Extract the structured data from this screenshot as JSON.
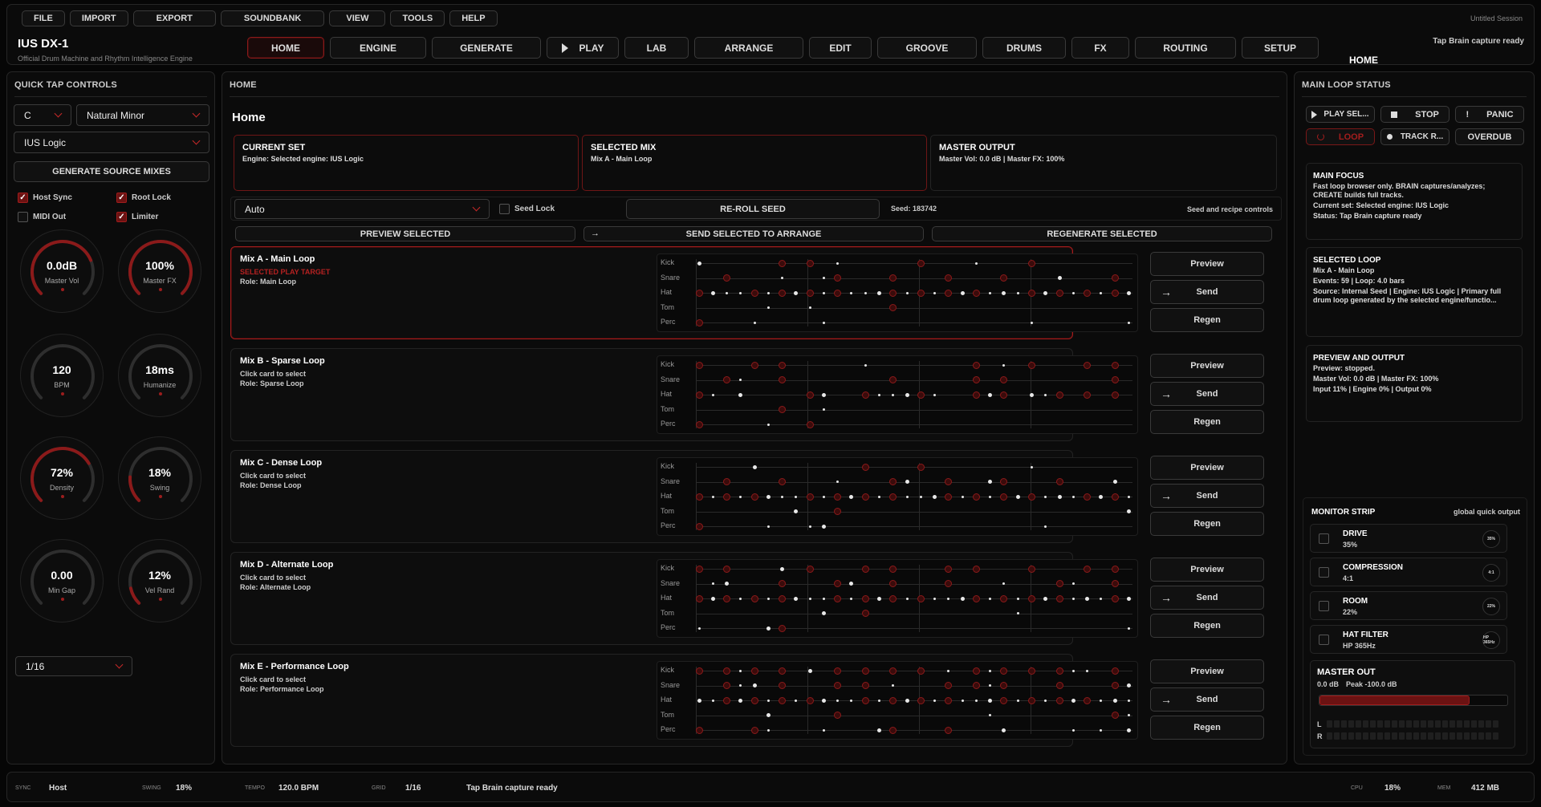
{
  "menu": [
    "FILE",
    "IMPORT",
    "EXPORT",
    "SOUNDBANK",
    "VIEW",
    "TOOLS",
    "HELP"
  ],
  "session": "Untitled Session",
  "app": {
    "title": "IUS DX-1",
    "subtitle": "Official Drum Machine and Rhythm Intelligence Engine"
  },
  "tabs": [
    "HOME",
    "ENGINE",
    "GENERATE",
    "PLAY",
    "LAB",
    "ARRANGE",
    "EDIT",
    "GROOVE",
    "DRUMS",
    "FX",
    "ROUTING",
    "SETUP"
  ],
  "active_tab": "HOME",
  "top_status": "Tap Brain capture ready",
  "left": {
    "title": "QUICK TAP CONTROLS",
    "key": "C",
    "scale": "Natural Minor",
    "engine": "IUS Logic",
    "generate_label": "GENERATE SOURCE MIXES",
    "checks": [
      {
        "label": "Host Sync",
        "on": true
      },
      {
        "label": "Root Lock",
        "on": true
      },
      {
        "label": "MIDI Out",
        "on": false
      },
      {
        "label": "Limiter",
        "on": true
      }
    ],
    "knobs": [
      {
        "value": "0.0dB",
        "label": "Master Vol",
        "level": 0.75
      },
      {
        "value": "100%",
        "label": "Master FX",
        "level": 1.0
      },
      {
        "value": "120",
        "label": "BPM",
        "level": 0.0
      },
      {
        "value": "18ms",
        "label": "Humanize",
        "level": 0.0
      },
      {
        "value": "72%",
        "label": "Density",
        "level": 0.72
      },
      {
        "value": "18%",
        "label": "Swing",
        "level": 0.18
      },
      {
        "value": "0.00",
        "label": "Min Gap",
        "level": 0.0
      },
      {
        "value": "12%",
        "label": "Vel Rand",
        "level": 0.12
      }
    ],
    "grid_value": "1/16"
  },
  "center": {
    "title": "HOME",
    "heading": "Home",
    "boxes": [
      {
        "title": "CURRENT SET",
        "text": "Engine: Selected engine: IUS Logic"
      },
      {
        "title": "SELECTED MIX",
        "text": "Mix A - Main Loop"
      },
      {
        "title": "MASTER OUTPUT",
        "text": "Master Vol: 0.0 dB | Master FX: 100%"
      }
    ],
    "mode": "Auto",
    "seed_lock": "Seed Lock",
    "reroll": "RE-ROLL SEED",
    "seed": "Seed: 183742",
    "seed_note": "Seed and recipe controls",
    "preview_sel": "PREVIEW SELECTED",
    "send_sel": "SEND SELECTED TO ARRANGE",
    "regen_sel": "REGENERATE SELECTED",
    "lanes": [
      "Kick",
      "Snare",
      "Hat",
      "Tom",
      "Perc"
    ],
    "actions": {
      "preview": "Preview",
      "send": "Send",
      "regen": "Regen"
    },
    "mixes": [
      {
        "title": "Mix A - Main Loop",
        "line1": "SELECTED PLAY TARGET",
        "line2": "Role: Main Loop",
        "selected": true,
        "pattern": [
          [
            0,
            6,
            8,
            10,
            16,
            20,
            24
          ],
          [
            2,
            6,
            9,
            10,
            14,
            18,
            22,
            26,
            30
          ],
          [
            0,
            1,
            2,
            3,
            4,
            5,
            6,
            7,
            8,
            9,
            10,
            11,
            12,
            13,
            14,
            15,
            16,
            17,
            18,
            19,
            20,
            21,
            22,
            23,
            24,
            25,
            26,
            27,
            28,
            29,
            30,
            31
          ],
          [
            5,
            8,
            14
          ],
          [
            0,
            4,
            9,
            24,
            31
          ]
        ]
      },
      {
        "title": "Mix B - Sparse Loop",
        "line1": "Click card to select",
        "line2": "Role: Sparse Loop",
        "selected": false,
        "pattern": [
          [
            0,
            4,
            6,
            12,
            20,
            22,
            24,
            28,
            30
          ],
          [
            2,
            3,
            6,
            14,
            20,
            22,
            30
          ],
          [
            0,
            1,
            3,
            8,
            9,
            12,
            13,
            14,
            15,
            16,
            17,
            20,
            21,
            22,
            24,
            25,
            26,
            28,
            30
          ],
          [
            6,
            9
          ],
          [
            0,
            5,
            8
          ]
        ]
      },
      {
        "title": "Mix C - Dense Loop",
        "line1": "Click card to select",
        "line2": "Role: Dense Loop",
        "selected": false,
        "pattern": [
          [
            4,
            12,
            16,
            24
          ],
          [
            2,
            6,
            10,
            14,
            15,
            18,
            21,
            22,
            26,
            30
          ],
          [
            0,
            1,
            2,
            3,
            4,
            5,
            6,
            7,
            8,
            9,
            10,
            11,
            12,
            13,
            14,
            15,
            16,
            17,
            18,
            19,
            20,
            21,
            22,
            23,
            24,
            25,
            26,
            27,
            28,
            29,
            30,
            31
          ],
          [
            7,
            10,
            31
          ],
          [
            0,
            5,
            8,
            9,
            25
          ]
        ]
      },
      {
        "title": "Mix D - Alternate Loop",
        "line1": "Click card to select",
        "line2": "Role: Alternate Loop",
        "selected": false,
        "pattern": [
          [
            0,
            2,
            6,
            8,
            12,
            14,
            18,
            20,
            24,
            28,
            30
          ],
          [
            1,
            2,
            6,
            10,
            11,
            14,
            18,
            22,
            26,
            27,
            30
          ],
          [
            0,
            1,
            2,
            3,
            4,
            5,
            6,
            7,
            8,
            9,
            10,
            11,
            12,
            13,
            14,
            15,
            16,
            17,
            18,
            19,
            20,
            21,
            22,
            23,
            24,
            25,
            26,
            27,
            28,
            29,
            30,
            31
          ],
          [
            9,
            12,
            23
          ],
          [
            0,
            5,
            6,
            31
          ]
        ]
      },
      {
        "title": "Mix E - Performance Loop",
        "line1": "Click card to select",
        "line2": "Role: Performance Loop",
        "selected": false,
        "pattern": [
          [
            0,
            2,
            3,
            4,
            6,
            8,
            10,
            12,
            14,
            16,
            18,
            20,
            21,
            22,
            24,
            26,
            27,
            28,
            30
          ],
          [
            2,
            3,
            4,
            6,
            10,
            12,
            14,
            18,
            20,
            21,
            22,
            26,
            30,
            31
          ],
          [
            0,
            1,
            2,
            3,
            4,
            5,
            6,
            7,
            8,
            9,
            10,
            11,
            12,
            13,
            14,
            15,
            16,
            17,
            18,
            19,
            20,
            21,
            22,
            23,
            24,
            25,
            26,
            27,
            28,
            29,
            30,
            31
          ],
          [
            5,
            10,
            21,
            30,
            31
          ],
          [
            0,
            4,
            5,
            9,
            13,
            14,
            18,
            22,
            27,
            29,
            31
          ]
        ]
      }
    ]
  },
  "right": {
    "title": "MAIN LOOP STATUS",
    "transport": [
      "PLAY SEL...",
      "STOP",
      "PANIC",
      "LOOP",
      "TRACK R...",
      "OVERDUB"
    ],
    "info": [
      {
        "title": "MAIN FOCUS",
        "lines": [
          "Fast loop browser only. BRAIN captures/analyzes; CREATE builds full tracks.",
          "Current set: Selected engine: IUS Logic",
          "Status: Tap Brain capture ready"
        ]
      },
      {
        "title": "SELECTED LOOP",
        "lines": [
          "Mix A - Main Loop",
          "Events: 59 | Loop: 4.0 bars",
          "Source: Internal Seed | Engine: IUS Logic | Primary full drum loop generated by the selected engine/functio..."
        ]
      },
      {
        "title": "PREVIEW AND OUTPUT",
        "lines": [
          "Preview: stopped.",
          "Master Vol: 0.0 dB | Master FX: 100%",
          "Input 11% | Engine 0% | Output 0%"
        ]
      }
    ],
    "monitor_title": "MONITOR STRIP",
    "monitor_note": "global quick output",
    "monitor": [
      {
        "name": "DRIVE",
        "value": "35%",
        "knob": "35%"
      },
      {
        "name": "COMPRESSION",
        "value": "4:1",
        "knob": "4:1"
      },
      {
        "name": "ROOM",
        "value": "22%",
        "knob": "22%"
      },
      {
        "name": "HAT FILTER",
        "value": "HP 365Hz",
        "knob": "HP 365Hz"
      }
    ],
    "master_out": {
      "title": "MASTER OUT",
      "db": "0.0 dB",
      "peak": "Peak -100.0 dB",
      "meter": 0.8,
      "L": "L",
      "R": "R"
    }
  },
  "footer": {
    "sync_l": "SYNC",
    "sync": "Host",
    "swing_l": "SWING",
    "swing": "18%",
    "tempo_l": "TEMPO",
    "tempo": "120.0 BPM",
    "grid_l": "GRID",
    "grid": "1/16",
    "status": "Tap Brain capture ready",
    "cpu_l": "CPU",
    "cpu": "18%",
    "mem_l": "MEM",
    "mem": "412 MB"
  },
  "colors": {
    "accent": "#a31d1d",
    "bg": "#060606",
    "panel": "#0b0b0b"
  }
}
